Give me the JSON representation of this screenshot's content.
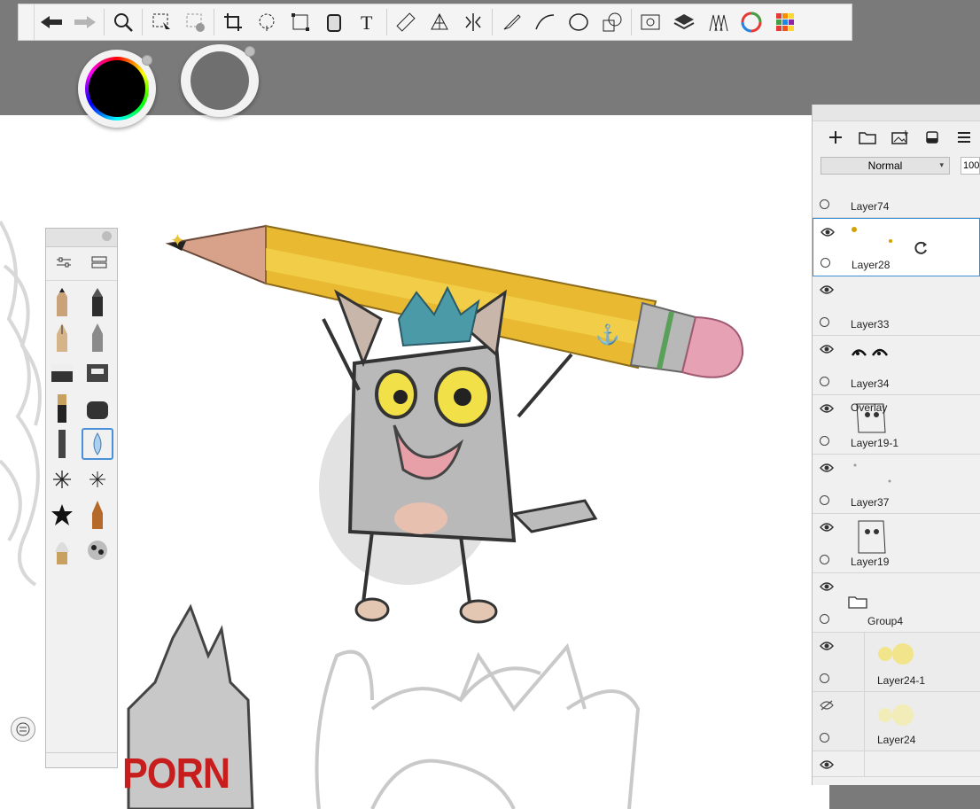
{
  "toolbar": {
    "tools": [
      "undo-icon",
      "redo-icon",
      "magnify-icon",
      "selection-icon",
      "selection-clear-icon",
      "crop-icon",
      "lasso-icon",
      "transform-icon",
      "fill-icon",
      "text-icon",
      "ruler-icon",
      "perspective-icon",
      "symmetry-icon",
      "pen-icon",
      "curve-icon",
      "ellipse-icon",
      "shapes-icon",
      "timelapse-icon",
      "layers-icon",
      "brush-library-icon",
      "color-wheel-icon",
      "color-palette-icon"
    ]
  },
  "colors": {
    "primary": "#000000",
    "secondary": "#6f6f6f"
  },
  "brushes": {
    "tabs": [
      "brush-settings-icon",
      "brush-sets-icon"
    ],
    "items": [
      "pencil-brush",
      "marker-brush",
      "ink-pen-brush",
      "airbrush-brush",
      "eraser-brush",
      "hard-eraser-brush",
      "paint-brush",
      "smudge-brush",
      "texture-brush",
      "water-drop-brush",
      "star-brush-1",
      "star-brush-2",
      "splatter-brush",
      "chalk-brush",
      "fan-brush",
      "noise-brush"
    ],
    "selected_index": 9
  },
  "layers": {
    "blend_mode": "Normal",
    "opacity": "100",
    "items": [
      {
        "name": "Layer74",
        "visible": false,
        "selected": false,
        "child": false
      },
      {
        "name": "Layer28",
        "visible": true,
        "selected": true,
        "child": false
      },
      {
        "name": "Layer33",
        "visible": true,
        "selected": false,
        "child": false
      },
      {
        "name": "Layer34",
        "visible": true,
        "selected": false,
        "child": false
      },
      {
        "name": "Layer19-1",
        "blend": "Overlay",
        "visible": true,
        "selected": false,
        "child": false
      },
      {
        "name": "Layer37",
        "visible": true,
        "selected": false,
        "child": false
      },
      {
        "name": "Layer19",
        "visible": true,
        "selected": false,
        "child": false
      },
      {
        "name": "Group4",
        "visible": true,
        "selected": false,
        "child": false,
        "group": true
      },
      {
        "name": "Layer24-1",
        "visible": true,
        "selected": false,
        "child": true
      },
      {
        "name": "Layer24",
        "visible": false,
        "selected": false,
        "child": true
      }
    ]
  },
  "watermark": {
    "text": "PORN"
  }
}
